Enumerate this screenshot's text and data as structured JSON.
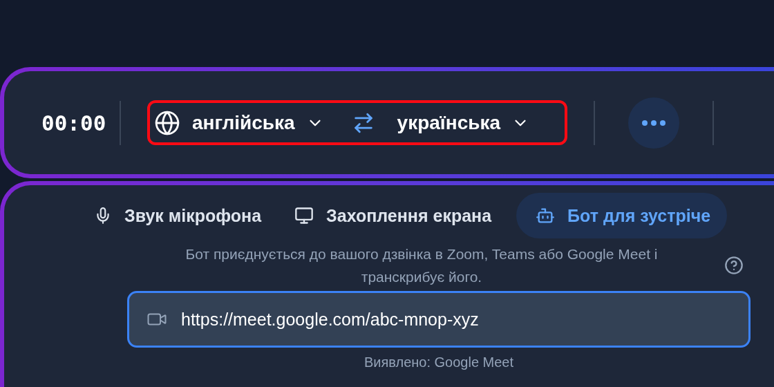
{
  "timer": "00:00",
  "language_selector": {
    "source": "англійська",
    "target": "українська"
  },
  "mode_tabs": [
    {
      "label": "Звук мікрофона",
      "kind": "microphone",
      "selected": false
    },
    {
      "label": "Захоплення екрана",
      "kind": "screen",
      "selected": false
    },
    {
      "label": "Бот для зустріче",
      "kind": "bot",
      "selected": true
    }
  ],
  "description": "Бот приєднується до вашого дзвінка в Zoom, Teams або Google Meet і транскрибує його.",
  "meeting_url": {
    "value": "https://meet.google.com/abc-mnop-xyz"
  },
  "detected": "Виявлено: Google Meet"
}
